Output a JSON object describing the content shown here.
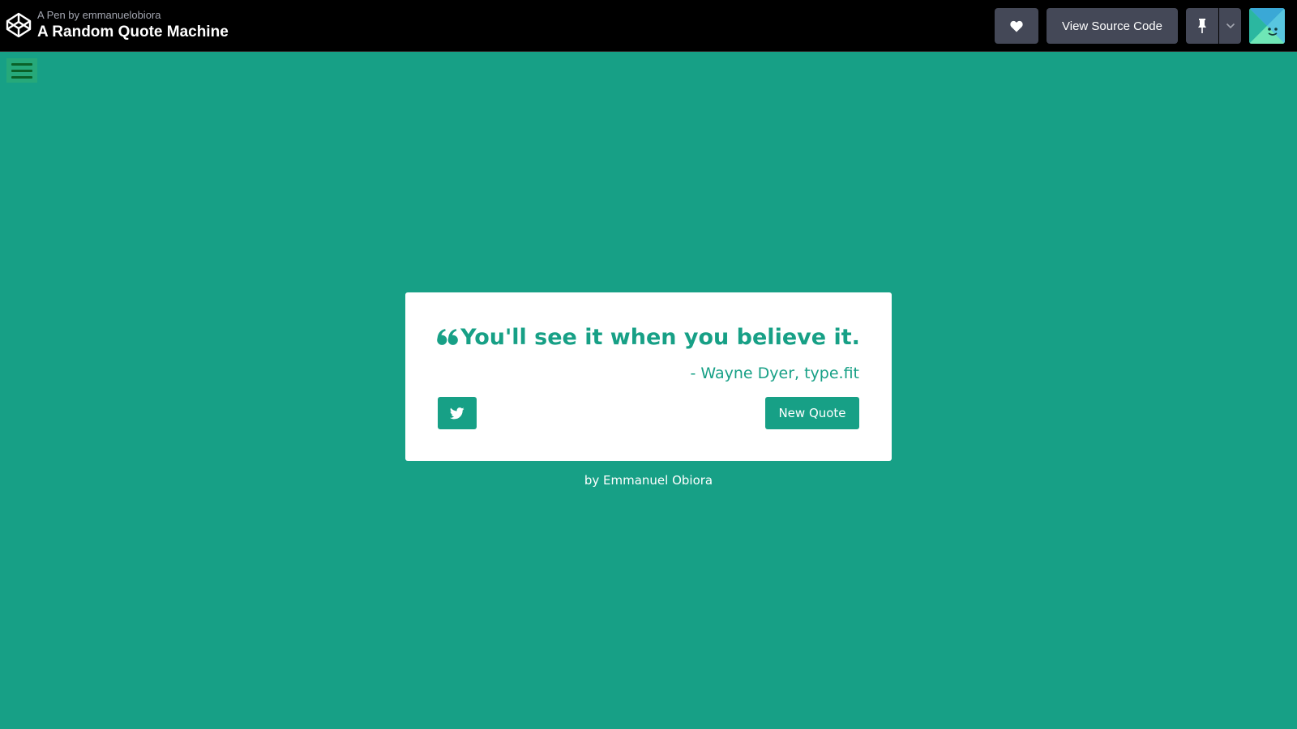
{
  "header": {
    "pen_by": "A Pen by emmanuelobiora",
    "pen_title": "A Random Quote Machine",
    "view_source_label": "View Source Code",
    "icons": {
      "logo": "codepen-logo-icon",
      "like": "heart-icon",
      "pin": "pin-icon",
      "dropdown": "chevron-down-icon",
      "avatar": "user-avatar"
    }
  },
  "app": {
    "quote": "You'll see it when you believe it.",
    "author": "- Wayne Dyer, type.fit",
    "new_quote_label": "New Quote",
    "byline": "by Emmanuel Obiora",
    "icons": {
      "menu": "hamburger-menu-icon",
      "quote_mark": "quote-left-icon",
      "tweet": "twitter-icon"
    }
  },
  "colors": {
    "background": "#17a086",
    "card": "#ffffff",
    "accent": "#17a086",
    "topbar": "#000000",
    "topbar_button": "#444857",
    "menu_button": "#26a97a",
    "menu_lines": "#0a6128"
  }
}
